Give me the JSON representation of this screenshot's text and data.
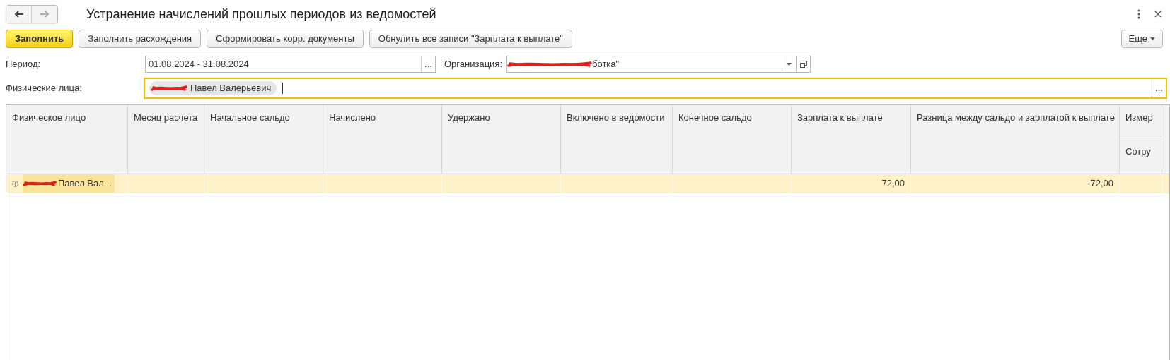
{
  "window": {
    "title": "Устранение начислений прошлых периодов из ведомостей"
  },
  "toolbar": {
    "buttons": [
      {
        "label": "Заполнить",
        "kind": "primary"
      },
      {
        "label": "Заполнить расхождения",
        "kind": "normal"
      },
      {
        "label": "Сформировать корр. документы",
        "kind": "normal"
      },
      {
        "label": "Обнулить все записи \"Зарплата к выплате\"",
        "kind": "normal"
      }
    ],
    "more": "Еще"
  },
  "form": {
    "period_label": "Период:",
    "period_value": "01.08.2024 - 31.08.2024",
    "org_label": "Организация:",
    "org_value": "ботка\"",
    "persons_label": "Физические лица:",
    "persons": [
      "Павел Валерьевич"
    ],
    "choose_button": "..."
  },
  "table": {
    "columns": [
      "Физическое лицо",
      "Месяц расчета",
      "Начальное сальдо",
      "Начислено",
      "Удержано",
      "Включено в ведомости",
      "Конечное сальдо",
      "Зарплата к выплате",
      "Разница между сальдо и зарплатой к выплате",
      "Измер"
    ],
    "subcolumn": "Сотру",
    "rows": [
      {
        "cells": [
          "Павел Вал...",
          "",
          "",
          "",
          "",
          "",
          "",
          "72,00",
          "-72,00",
          ""
        ],
        "selected": true
      }
    ]
  }
}
